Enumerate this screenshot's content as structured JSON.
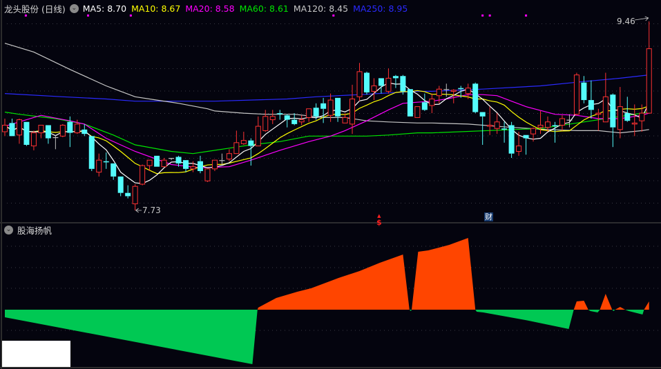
{
  "header": {
    "title": "龙头股份 (日线)",
    "ma_legend": [
      {
        "label": "MA5:",
        "value": "8.70",
        "color": "#ffffff"
      },
      {
        "label": "MA10:",
        "value": "8.67",
        "color": "#ffff00"
      },
      {
        "label": "MA20:",
        "value": "8.58",
        "color": "#ff00ff"
      },
      {
        "label": "MA60:",
        "value": "8.61",
        "color": "#00e600"
      },
      {
        "label": "MA120:",
        "value": "8.45",
        "color": "#c8c8c8"
      },
      {
        "label": "MA250:",
        "value": "8.95",
        "color": "#2a2aff"
      }
    ]
  },
  "colors": {
    "up": "#ff3232",
    "down": "#54fcfc",
    "flat": "#c0c0c0",
    "ind_pos": "#ff4500",
    "ind_neg": "#00c853",
    "event_marker": "#ff00ff"
  },
  "chart_data": {
    "type": "candlestick",
    "title": "龙头股份 (日线)",
    "candle_fields": [
      "open",
      "high",
      "low",
      "close"
    ],
    "candles": [
      [
        8.45,
        8.57,
        8.41,
        8.51
      ],
      [
        8.53,
        8.57,
        8.41,
        8.41
      ],
      [
        8.42,
        8.57,
        8.34,
        8.56
      ],
      [
        8.54,
        8.54,
        8.32,
        8.33
      ],
      [
        8.32,
        8.46,
        8.28,
        8.44
      ],
      [
        8.44,
        8.51,
        8.39,
        8.51
      ],
      [
        8.51,
        8.51,
        8.34,
        8.39
      ],
      [
        8.4,
        8.42,
        8.29,
        8.4
      ],
      [
        8.41,
        8.52,
        8.4,
        8.51
      ],
      [
        8.54,
        8.59,
        8.31,
        8.44
      ],
      [
        8.44,
        8.56,
        8.43,
        8.52
      ],
      [
        8.47,
        8.52,
        8.41,
        8.43
      ],
      [
        8.41,
        8.41,
        8.09,
        8.11
      ],
      [
        8.08,
        8.25,
        8.04,
        8.19
      ],
      [
        8.18,
        8.26,
        8.11,
        8.17
      ],
      [
        8.16,
        8.16,
        8.01,
        8.04
      ],
      [
        8.04,
        8.04,
        7.86,
        7.89
      ],
      [
        7.89,
        7.96,
        7.84,
        7.86
      ],
      [
        7.79,
        7.97,
        7.73,
        7.95
      ],
      [
        7.97,
        8.15,
        7.96,
        8.14
      ],
      [
        8.14,
        8.19,
        8.09,
        8.19
      ],
      [
        8.23,
        8.23,
        8.13,
        8.13
      ],
      [
        8.13,
        8.21,
        8.13,
        8.19
      ],
      [
        8.21,
        8.21,
        8.19,
        8.21
      ],
      [
        8.22,
        8.23,
        8.13,
        8.16
      ],
      [
        8.19,
        8.19,
        8.08,
        8.11
      ],
      [
        8.11,
        8.18,
        8.08,
        8.13
      ],
      [
        8.18,
        8.23,
        8.07,
        8.09
      ],
      [
        8.0,
        8.11,
        7.99,
        8.11
      ],
      [
        8.11,
        8.19,
        8.09,
        8.19
      ],
      [
        8.19,
        8.25,
        8.14,
        8.19
      ],
      [
        8.2,
        8.29,
        8.18,
        8.25
      ],
      [
        8.25,
        8.46,
        8.25,
        8.35
      ],
      [
        8.34,
        8.45,
        8.33,
        8.37
      ],
      [
        8.37,
        8.39,
        8.14,
        8.32
      ],
      [
        8.32,
        8.59,
        8.32,
        8.5
      ],
      [
        8.46,
        8.65,
        8.45,
        8.59
      ],
      [
        8.56,
        8.65,
        8.52,
        8.59
      ],
      [
        8.62,
        8.65,
        8.56,
        8.61
      ],
      [
        8.6,
        8.61,
        8.49,
        8.56
      ],
      [
        8.56,
        8.62,
        8.51,
        8.52
      ],
      [
        8.54,
        8.6,
        8.51,
        8.56
      ],
      [
        8.58,
        8.66,
        8.54,
        8.66
      ],
      [
        8.67,
        8.71,
        8.56,
        8.59
      ],
      [
        8.71,
        8.76,
        8.53,
        8.66
      ],
      [
        8.6,
        8.8,
        8.54,
        8.74
      ],
      [
        8.76,
        8.76,
        8.54,
        8.59
      ],
      [
        8.53,
        8.62,
        8.53,
        8.58
      ],
      [
        8.52,
        8.88,
        8.43,
        8.75
      ],
      [
        8.77,
        9.08,
        8.73,
        9.0
      ],
      [
        8.99,
        9.0,
        8.79,
        8.81
      ],
      [
        8.82,
        8.94,
        8.74,
        8.87
      ],
      [
        8.94,
        8.94,
        8.8,
        8.87
      ],
      [
        8.82,
        9.03,
        8.8,
        8.94
      ],
      [
        8.96,
        8.97,
        8.85,
        8.94
      ],
      [
        8.96,
        8.97,
        8.79,
        8.82
      ],
      [
        8.84,
        8.84,
        8.59,
        8.59
      ],
      [
        8.58,
        8.68,
        8.58,
        8.68
      ],
      [
        8.72,
        8.8,
        8.64,
        8.65
      ],
      [
        8.69,
        8.8,
        8.62,
        8.75
      ],
      [
        8.78,
        8.87,
        8.71,
        8.84
      ],
      [
        8.84,
        8.89,
        8.77,
        8.84
      ],
      [
        8.82,
        8.84,
        8.71,
        8.83
      ],
      [
        8.85,
        8.87,
        8.76,
        8.84
      ],
      [
        8.8,
        8.89,
        8.75,
        8.85
      ],
      [
        8.89,
        8.9,
        8.62,
        8.63
      ],
      [
        8.63,
        8.63,
        8.33,
        8.59
      ],
      [
        8.5,
        8.68,
        8.42,
        8.51
      ],
      [
        8.48,
        8.62,
        8.43,
        8.54
      ],
      [
        8.48,
        8.54,
        8.35,
        8.47
      ],
      [
        8.51,
        8.54,
        8.21,
        8.25
      ],
      [
        8.27,
        8.45,
        8.23,
        8.32
      ],
      [
        8.42,
        8.42,
        8.24,
        8.39
      ],
      [
        8.43,
        8.49,
        8.36,
        8.48
      ],
      [
        8.49,
        8.64,
        8.43,
        8.51
      ],
      [
        8.49,
        8.59,
        8.45,
        8.54
      ],
      [
        8.51,
        8.54,
        8.35,
        8.5
      ],
      [
        8.51,
        8.6,
        8.46,
        8.57
      ],
      [
        8.56,
        8.61,
        8.49,
        8.56
      ],
      [
        8.61,
        8.99,
        8.6,
        8.97
      ],
      [
        8.9,
        8.96,
        8.71,
        8.74
      ],
      [
        8.74,
        8.92,
        8.57,
        8.65
      ],
      [
        8.61,
        8.66,
        8.46,
        8.62
      ],
      [
        8.54,
        8.99,
        8.54,
        8.77
      ],
      [
        8.79,
        8.8,
        8.31,
        8.49
      ],
      [
        8.47,
        8.86,
        8.39,
        8.68
      ],
      [
        8.62,
        8.77,
        8.54,
        8.55
      ],
      [
        8.52,
        8.7,
        8.41,
        8.53
      ],
      [
        8.55,
        8.7,
        8.45,
        8.62
      ],
      [
        8.62,
        9.46,
        8.62,
        9.21
      ]
    ],
    "ma_series": {
      "MA20": [
        [
          0,
          8.5
        ],
        [
          5,
          8.6
        ],
        [
          9,
          8.55
        ],
        [
          11,
          8.52
        ],
        [
          14,
          8.39
        ],
        [
          18,
          8.27
        ],
        [
          23,
          8.15
        ],
        [
          27,
          8.12
        ],
        [
          31,
          8.13
        ],
        [
          34,
          8.19
        ],
        [
          38,
          8.28
        ],
        [
          42,
          8.36
        ],
        [
          45,
          8.41
        ],
        [
          47,
          8.46
        ],
        [
          50,
          8.55
        ],
        [
          53,
          8.65
        ],
        [
          55,
          8.71
        ],
        [
          57,
          8.72
        ],
        [
          59,
          8.73
        ],
        [
          61,
          8.75
        ],
        [
          64,
          8.79
        ],
        [
          66,
          8.79
        ],
        [
          68,
          8.78
        ],
        [
          70,
          8.73
        ],
        [
          72,
          8.68
        ],
        [
          76,
          8.61
        ],
        [
          79,
          8.6
        ],
        [
          81,
          8.58
        ],
        [
          82,
          8.57
        ],
        [
          85,
          8.57
        ],
        [
          88,
          8.6
        ],
        [
          89,
          8.62
        ]
      ],
      "MA60": [
        [
          0,
          8.63
        ],
        [
          2,
          8.61
        ],
        [
          7,
          8.57
        ],
        [
          11,
          8.52
        ],
        [
          15,
          8.42
        ],
        [
          18,
          8.33
        ],
        [
          23,
          8.27
        ],
        [
          26,
          8.25
        ],
        [
          28,
          8.27
        ],
        [
          31,
          8.3
        ],
        [
          34,
          8.33
        ],
        [
          38,
          8.36
        ],
        [
          42,
          8.41
        ],
        [
          44,
          8.41
        ],
        [
          47,
          8.41
        ],
        [
          50,
          8.41
        ],
        [
          53,
          8.42
        ],
        [
          57,
          8.44
        ],
        [
          59,
          8.44
        ],
        [
          74,
          8.48
        ],
        [
          80,
          8.54
        ],
        [
          89,
          8.63
        ]
      ],
      "MA120": [
        [
          0,
          9.26
        ],
        [
          4,
          9.18
        ],
        [
          9,
          9.02
        ],
        [
          14,
          8.87
        ],
        [
          18,
          8.77
        ],
        [
          21,
          8.74
        ],
        [
          24,
          8.71
        ],
        [
          28,
          8.66
        ],
        [
          29,
          8.64
        ],
        [
          33,
          8.62
        ],
        [
          36,
          8.61
        ],
        [
          40,
          8.61
        ],
        [
          44,
          8.58
        ],
        [
          47,
          8.58
        ],
        [
          50,
          8.55
        ],
        [
          53,
          8.54
        ],
        [
          57,
          8.53
        ],
        [
          59,
          8.53
        ],
        [
          64,
          8.52
        ],
        [
          70,
          8.49
        ],
        [
          75,
          8.47
        ],
        [
          79,
          8.46
        ],
        [
          82,
          8.46
        ],
        [
          85,
          8.44
        ],
        [
          88,
          8.46
        ],
        [
          89,
          8.47
        ]
      ],
      "MA250": [
        [
          0,
          8.8
        ],
        [
          8,
          8.77
        ],
        [
          14,
          8.75
        ],
        [
          18,
          8.73
        ],
        [
          29,
          8.73
        ],
        [
          39,
          8.75
        ],
        [
          43,
          8.77
        ],
        [
          49,
          8.79
        ],
        [
          57,
          8.82
        ],
        [
          59,
          8.82
        ],
        [
          66,
          8.84
        ],
        [
          74,
          8.87
        ],
        [
          80,
          8.91
        ],
        [
          85,
          8.94
        ],
        [
          89,
          8.97
        ]
      ]
    },
    "ma_computed": [
      "MA5",
      "MA10"
    ],
    "price_range": [
      7.73,
      9.46
    ],
    "high_label": "9.46",
    "low_label": "7.73",
    "high_index": 89,
    "low_index": 18,
    "event_marker_indices": [
      2.9,
      11.5,
      17.4,
      45.4,
      66,
      67,
      72
    ],
    "bottom_events": [
      {
        "index": 52,
        "label": "$"
      },
      {
        "index": 67,
        "label": "财"
      }
    ],
    "indicator": {
      "title": "股海扬帆",
      "type": "area",
      "points": [
        [
          0,
          0
        ],
        [
          0,
          -11
        ],
        [
          34.2,
          -79
        ],
        [
          34.9,
          0
        ],
        [
          35,
          3
        ],
        [
          37.5,
          17
        ],
        [
          40.4,
          26
        ],
        [
          42.3,
          31
        ],
        [
          45.1,
          42
        ],
        [
          46.1,
          46
        ],
        [
          49,
          56
        ],
        [
          51.8,
          68
        ],
        [
          55,
          80
        ],
        [
          55.9,
          0
        ],
        [
          56.1,
          -2
        ],
        [
          56.2,
          0
        ],
        [
          57.1,
          84
        ],
        [
          58.5,
          86
        ],
        [
          61.4,
          94
        ],
        [
          64,
          104
        ],
        [
          65,
          0
        ],
        [
          65.2,
          -3
        ],
        [
          66.1,
          -4
        ],
        [
          71.9,
          -15
        ],
        [
          77.9,
          -28
        ],
        [
          78.6,
          0
        ],
        [
          79,
          12
        ],
        [
          80,
          13
        ],
        [
          80.6,
          0
        ],
        [
          80.9,
          -2
        ],
        [
          81.9,
          -4
        ],
        [
          82.2,
          0
        ],
        [
          83,
          23
        ],
        [
          83.9,
          0
        ],
        [
          84.1,
          -2
        ],
        [
          84.3,
          0
        ],
        [
          85,
          4
        ],
        [
          85.7,
          0
        ],
        [
          86.2,
          -2
        ],
        [
          88.1,
          -7
        ],
        [
          88.3,
          0
        ],
        [
          89,
          12
        ]
      ],
      "range": [
        -84,
        111
      ]
    }
  }
}
